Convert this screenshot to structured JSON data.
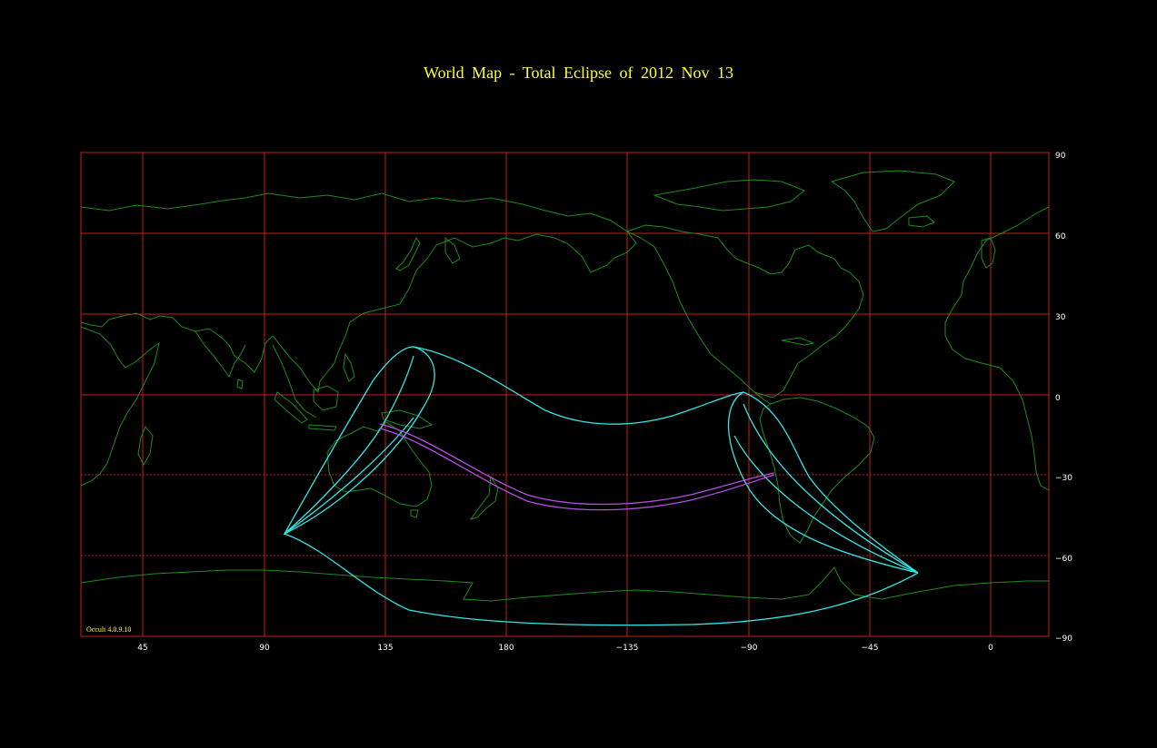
{
  "title": "World Map  -  Total  Eclipse  of  2012 Nov 13",
  "version_label": "Occult 4.0.9.10",
  "colors": {
    "grid": "#c81e1e",
    "coastline": "#1e8c1e",
    "eclipse_boundary": "#33e6e6",
    "central_path": "#b44fe0",
    "title": "#ffff33"
  },
  "axes": {
    "x_ticks": [
      "45",
      "90",
      "135",
      "180",
      "−135",
      "−90",
      "−45",
      "0"
    ],
    "y_ticks": [
      "90",
      "60",
      "30",
      "0",
      "−30",
      "−60",
      "−90"
    ]
  }
}
